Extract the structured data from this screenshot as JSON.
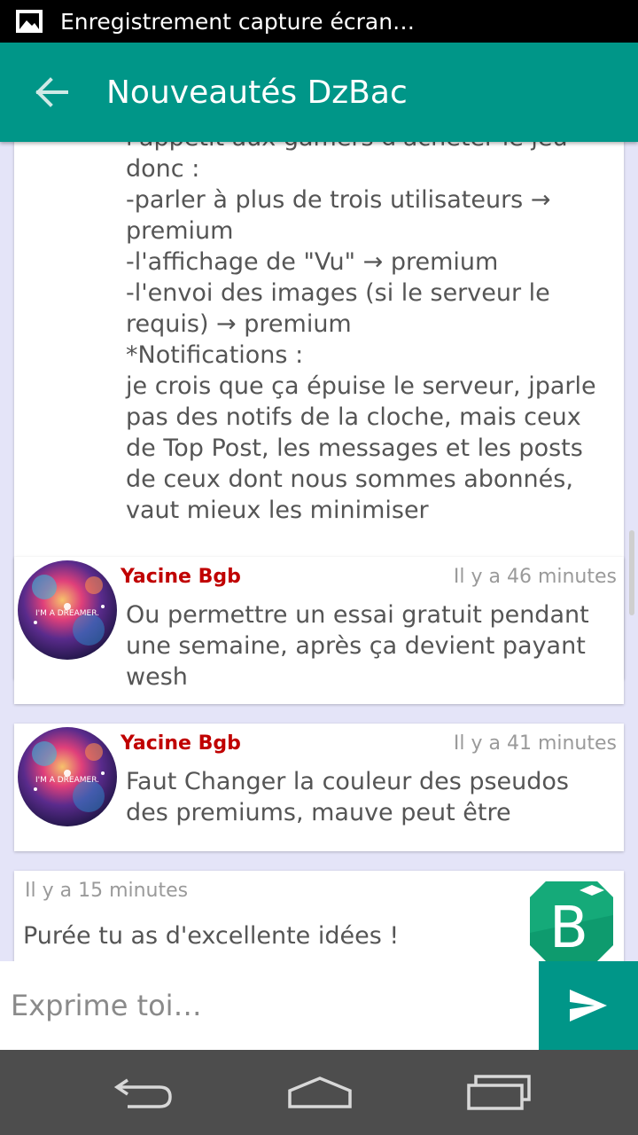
{
  "status_bar": {
    "notification_text": "Enregistrement capture écran…",
    "icon": "image-icon"
  },
  "app_bar": {
    "title": "Nouveautés DzBac",
    "back_icon": "arrow-left-icon",
    "color": "#009688"
  },
  "post": {
    "body": "l'appétit aux gamers d'acheter le jeu\ndonc :\n-parler à plus de trois utilisateurs → premium\n-l'affichage de \"Vu\" → premium\n-l'envoi des images (si le serveur le requis) → premium\n*Notifications :\nje crois que ça épuise le serveur, jparle pas des notifs de la cloche, mais ceux de Top Post, les messages et les posts de ceux dont nous sommes abonnés, vaut mieux les minimiser"
  },
  "comments": [
    {
      "author": "Yacine Bgb",
      "time": "Il y a 46 minutes",
      "text": "Ou permettre un essai gratuit pendant une semaine, après ça devient payant wesh",
      "avatar_text": "I'M A DREAMER."
    },
    {
      "author": "Yacine Bgb",
      "time": "Il y a 41 minutes",
      "text": "Faut Changer la couleur des pseudos des premiums, mauve peut être",
      "avatar_text": "I'M A DREAMER."
    }
  ],
  "reply": {
    "time": "Il y a 15 minutes",
    "text": "Purée tu as d'excellente idées !",
    "logo_letter": "B"
  },
  "composer": {
    "placeholder": "Exprime toi…",
    "send_icon": "send-icon"
  },
  "colors": {
    "accent": "#009688",
    "author_name": "#c00000",
    "feed_background": "#e4e4f8"
  },
  "nav": {
    "icons": [
      "back-nav-icon",
      "home-nav-icon",
      "recent-apps-icon"
    ]
  }
}
